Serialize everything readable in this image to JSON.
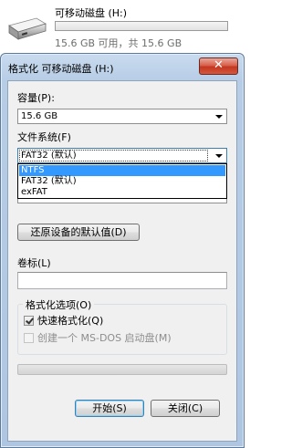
{
  "drive": {
    "name": "可移动磁盘 (H:)",
    "space_text": "15.6 GB 可用，共 15.6 GB",
    "used_fraction": 0.0,
    "icon": "usb-drive-icon"
  },
  "dialog": {
    "title": "格式化 可移动磁盘 (H:)",
    "close_label": "✕",
    "capacity_label": "容量(P):",
    "capacity_value": "15.6 GB",
    "filesystem_label": "文件系统(F)",
    "filesystem_value": "FAT32 (默认)",
    "filesystem_options": [
      "NTFS",
      "FAT32 (默认)",
      "exFAT"
    ],
    "filesystem_highlighted": "NTFS",
    "allocation_value": "",
    "restore_defaults_label": "还原设备的默认值(D)",
    "volume_label_label": "卷标(L)",
    "volume_label_value": "",
    "format_options_title": "格式化选项(O)",
    "quick_format_label": "快速格式化(Q)",
    "quick_format_checked": true,
    "msdos_label": "创建一个 MS-DOS 启动盘(M)",
    "msdos_checked": false,
    "progress_fraction": 0.0,
    "start_label": "开始(S)",
    "close_button_label": "关闭(C)"
  },
  "colors": {
    "title_gradient_top": "#c9dbee",
    "selection": "#3399ff",
    "close_red": "#c4371f"
  }
}
